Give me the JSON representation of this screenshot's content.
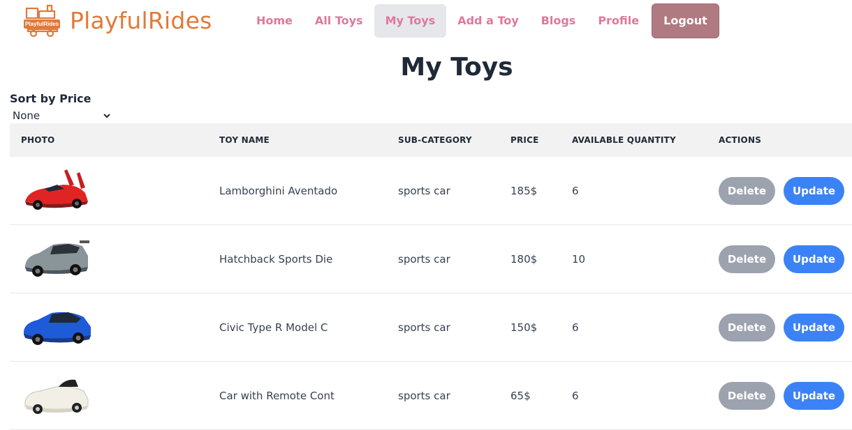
{
  "brand": {
    "name": "PlayfulRides",
    "badge": "PlayfulRides",
    "color": "#e07a3a"
  },
  "nav": {
    "items": [
      {
        "label": "Home",
        "active": false
      },
      {
        "label": "All Toys",
        "active": false
      },
      {
        "label": "My Toys",
        "active": true
      },
      {
        "label": "Add a Toy",
        "active": false
      },
      {
        "label": "Blogs",
        "active": false
      },
      {
        "label": "Profile",
        "active": false
      }
    ],
    "logout": "Logout",
    "accent": "#e0789a",
    "logout_color": "#b07a82"
  },
  "page": {
    "title": "My Toys"
  },
  "sort": {
    "label": "Sort by Price",
    "selected": "None"
  },
  "table": {
    "headers": {
      "photo": "PHOTO",
      "name": "TOY NAME",
      "sub": "SUB-CATEGORY",
      "price": "PRICE",
      "qty": "AVAILABLE QUANTITY",
      "actions": "ACTIONS"
    },
    "rows": [
      {
        "name": "Lamborghini Aventado",
        "sub": "sports car",
        "price": "185$",
        "qty": "6",
        "photo": "red-sports-car-image"
      },
      {
        "name": "Hatchback Sports Die",
        "sub": "sports car",
        "price": "180$",
        "qty": "10",
        "photo": "grey-hatchback-image"
      },
      {
        "name": "Civic Type R Model C",
        "sub": "sports car",
        "price": "150$",
        "qty": "6",
        "photo": "blue-civic-image"
      },
      {
        "name": "Car with Remote Cont",
        "sub": "sports car",
        "price": "65$",
        "qty": "6",
        "photo": "white-ride-on-car-image"
      }
    ],
    "delete_label": "Delete",
    "update_label": "Update",
    "delete_color": "#9ca3af",
    "update_color": "#3b82f6"
  }
}
